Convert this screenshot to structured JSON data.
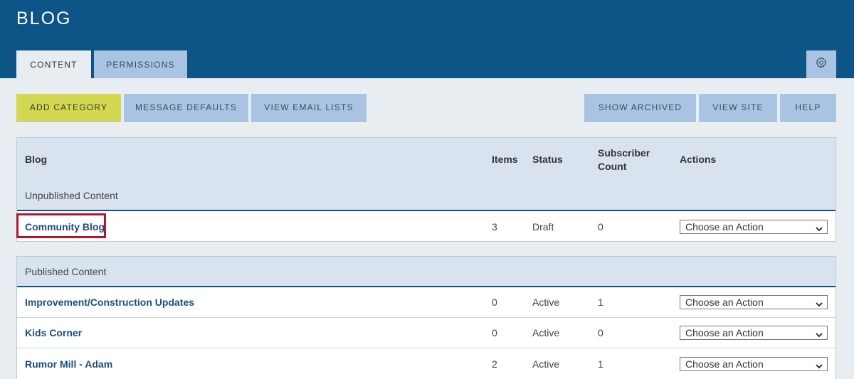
{
  "header": {
    "title": "BLOG",
    "tabs": [
      {
        "label": "CONTENT",
        "active": true
      },
      {
        "label": "PERMISSIONS",
        "active": false
      }
    ]
  },
  "toolbar": {
    "add_category": "ADD CATEGORY",
    "message_defaults": "MESSAGE DEFAULTS",
    "view_email_lists": "VIEW EMAIL LISTS",
    "show_archived": "SHOW ARCHIVED",
    "view_site": "VIEW SITE",
    "help": "HELP"
  },
  "table": {
    "columns": {
      "blog": "Blog",
      "items": "Items",
      "status": "Status",
      "subscriber_count": "Subscriber Count",
      "actions": "Actions"
    },
    "unpublished_label": "Unpublished Content",
    "published_label": "Published Content",
    "unpublished_rows": [
      {
        "name": "Community Blog",
        "items": "3",
        "status": "Draft",
        "subscribers": "0",
        "action": "Choose an Action"
      }
    ],
    "published_rows": [
      {
        "name": "Improvement/Construction Updates",
        "items": "0",
        "status": "Active",
        "subscribers": "1",
        "action": "Choose an Action"
      },
      {
        "name": "Kids Corner",
        "items": "0",
        "status": "Active",
        "subscribers": "0",
        "action": "Choose an Action"
      },
      {
        "name": "Rumor Mill - Adam",
        "items": "2",
        "status": "Active",
        "subscribers": "1",
        "action": "Choose an Action"
      }
    ]
  },
  "colors": {
    "header_bg": "#0d5587",
    "accent_button": "#d2d851",
    "secondary_button": "#a9c4e2",
    "highlight_border": "#b5162b",
    "link": "#1d4d7a"
  }
}
